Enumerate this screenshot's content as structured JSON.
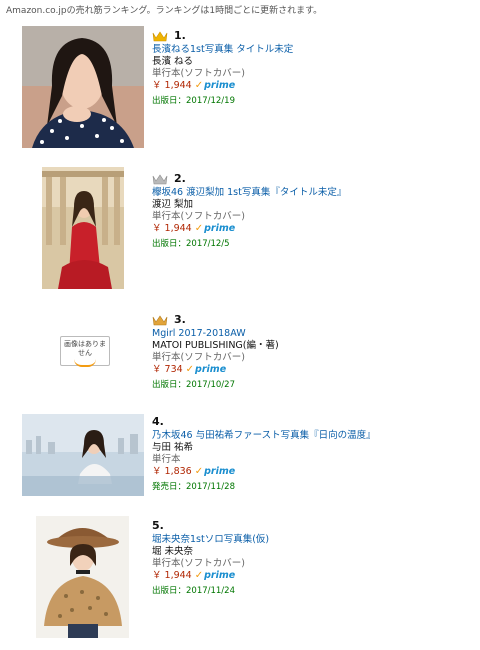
{
  "header": {
    "text": "Amazon.co.jpの売れ筋ランキング。ランキングは1時間ごとに更新されます。"
  },
  "items": [
    {
      "rank": "1.",
      "crown": "gold-crown-icon",
      "title": "長濱ねる1st写真集 タイトル未定",
      "author": "長濱 ねる",
      "format": "単行本(ソフトカバー)",
      "price": "￥ 1,944",
      "prime": "prime",
      "date": "出版日：2017/12/19"
    },
    {
      "rank": "2.",
      "crown": "silver-crown-icon",
      "title": "欅坂46 渡辺梨加 1st写真集『タイトル未定』",
      "author": "渡辺 梨加",
      "format": "単行本(ソフトカバー)",
      "price": "￥ 1,944",
      "prime": "prime",
      "date": "出版日：2017/12/5"
    },
    {
      "rank": "3.",
      "crown": "bronze-crown-icon",
      "title": "Mgirl 2017-2018AW",
      "author": "MATOI PUBLISHING(編・著)",
      "format": "単行本(ソフトカバー)",
      "price": "￥ 734",
      "prime": "prime",
      "date": "出版日：2017/10/27",
      "noimage": "画像はありません"
    },
    {
      "rank": "4.",
      "title": "乃木坂46 与田祐希ファースト写真集『日向の温度』",
      "author": "与田 祐希",
      "format": "単行本",
      "price": "￥ 1,836",
      "prime": "prime",
      "date": "発売日：2017/11/28"
    },
    {
      "rank": "5.",
      "title": "堀未央奈1stソロ写真集(仮)",
      "author": "堀 未央奈",
      "format": "単行本(ソフトカバー)",
      "price": "￥ 1,944",
      "prime": "prime",
      "date": "出版日：2017/11/24"
    }
  ]
}
